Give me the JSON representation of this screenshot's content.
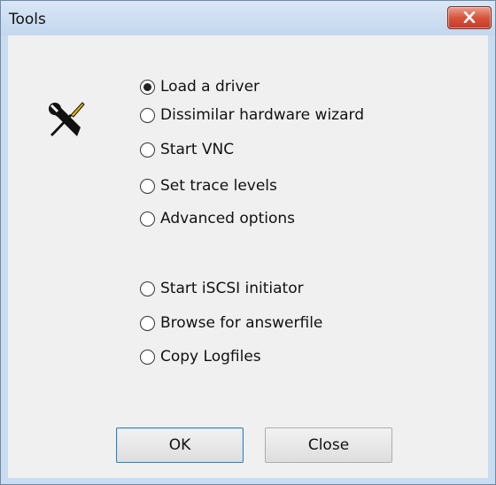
{
  "window": {
    "title": "Tools"
  },
  "titlebar": {
    "close_icon": "close-x-icon"
  },
  "icon": {
    "name": "tools-icon"
  },
  "options": {
    "group1": [
      {
        "label": "Load a driver",
        "selected": true
      },
      {
        "label": "Dissimilar hardware wizard",
        "selected": false
      },
      {
        "label": "Start VNC",
        "selected": false
      },
      {
        "label": "Set trace levels",
        "selected": false
      },
      {
        "label": "Advanced options",
        "selected": false
      }
    ],
    "group2": [
      {
        "label": "Start iSCSI initiator",
        "selected": false
      },
      {
        "label": "Browse for answerfile",
        "selected": false
      },
      {
        "label": "Copy Logfiles",
        "selected": false
      }
    ]
  },
  "buttons": {
    "ok_label": "OK",
    "close_label": "Close"
  },
  "colors": {
    "close_button": "#c4392a",
    "default_button_border": "#3c7fb1"
  }
}
